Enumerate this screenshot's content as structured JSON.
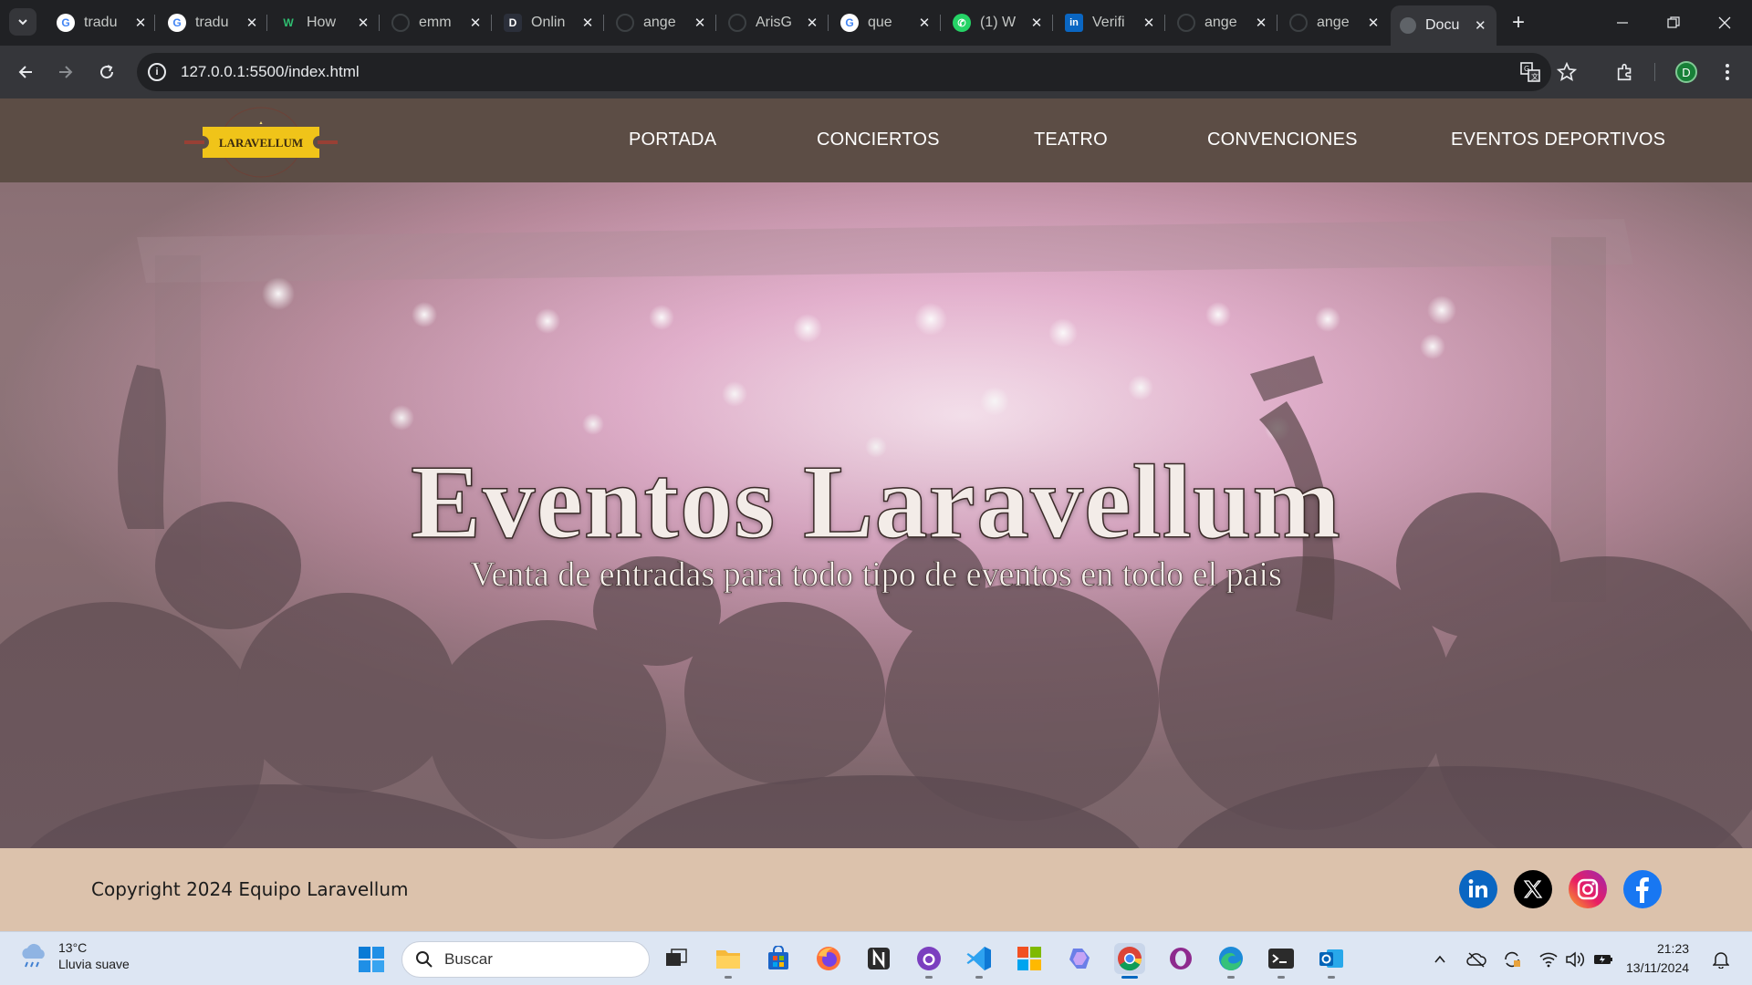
{
  "browser": {
    "tabs": [
      {
        "title": "tradu",
        "favicon": "google-g-icon"
      },
      {
        "title": "tradu",
        "favicon": "google-g-icon"
      },
      {
        "title": "How",
        "favicon": "w-logo-icon"
      },
      {
        "title": "emm",
        "favicon": "github-icon"
      },
      {
        "title": "Onlin",
        "favicon": "d-logo-icon"
      },
      {
        "title": "ange",
        "favicon": "github-icon"
      },
      {
        "title": "ArisG",
        "favicon": "github-icon"
      },
      {
        "title": "que",
        "favicon": "google-g-icon"
      },
      {
        "title": "(1) W",
        "favicon": "whatsapp-icon"
      },
      {
        "title": "Verifi",
        "favicon": "linkedin-icon"
      },
      {
        "title": "ange",
        "favicon": "github-icon"
      },
      {
        "title": "ange",
        "favicon": "github-icon"
      },
      {
        "title": "Docu",
        "favicon": "globe-icon",
        "active": true
      }
    ],
    "url": "127.0.0.1:5500/index.html",
    "profile_initial": "D"
  },
  "site": {
    "logo_text": "LARAVELLUM",
    "nav": [
      "PORTADA",
      "CONCIERTOS",
      "TEATRO",
      "CONVENCIONES",
      "EVENTOS DEPORTIVOS"
    ],
    "hero": {
      "title": "Eventos Laravellum",
      "subtitle": "Venta de entradas para todo tipo de eventos en todo el pais"
    },
    "footer": {
      "copyright": "Copyright 2024 Equipo Laravellum",
      "social": [
        "linkedin-icon",
        "x-icon",
        "instagram-icon",
        "facebook-icon"
      ]
    },
    "colors": {
      "nav_bg": "#5c4d45",
      "footer_bg": "#dcc2ac",
      "logo_ticket": "#f0c419"
    }
  },
  "taskbar": {
    "weather_temp": "13°C",
    "weather_desc": "Lluvia suave",
    "search_label": "Buscar",
    "time": "21:23",
    "date": "13/11/2024"
  }
}
